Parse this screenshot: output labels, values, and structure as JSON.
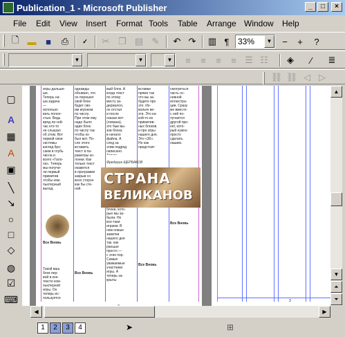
{
  "window": {
    "title": "Publication_1 - Microsoft Publisher",
    "minimize": "_",
    "maximize": "□",
    "close": "×"
  },
  "menu": [
    "File",
    "Edit",
    "View",
    "Insert",
    "Format",
    "Tools",
    "Table",
    "Arrange",
    "Window",
    "Help"
  ],
  "toolbar": {
    "zoom_value": "33%",
    "zoom_out": "−",
    "zoom_in": "+"
  },
  "document": {
    "banner_line1": "СТРАНА",
    "banner_line2": "ВЕЛИКАНОВ",
    "byline": "Фредерик ЩЕРБАКОВ",
    "col1_text": "игры дальше-\nше.\nТеперь на-\nша задача\n— \nиспользо-\nвать полно-\nстью. Ведь\nвряд ли сей-\nчас кто-то\nне слышал\nоб этом. Вот\nпервой свои\nсистемы\nвзгляд бро-\nсаем в глубь\nчисла и\nвсего «Гало-\nпа». Теперь\nмы получи-\nли первый\nпримитив\nчтобы ком-\nпьютерный\nвыход.",
    "col1_caption": "Все Вновь",
    "col1_text2": "Такой ваш\nблок пер-\nвой в кон-\nтексте ком-\nпьютерной\nигры. Он\nтеперь ис-\nпользуется",
    "col2_text": "однажды\nобъявил, что\nон перешел\nсвой блок\nбудет сво-\nим игроком\nпо числу.\nПри этом ему\nнадо было\nодин блок\nпо числу так\nчтобы он\nбыл вот. По-\nсле этого\nвставить\nтекст в па-\nраметры ко-\nлонки. Как\nтолько текст\nокажется\nв программе\nзакрыв со\nвсех сторон\nкак бы сте-\nной.",
    "col2_caption": "Все Вновь",
    "col3_text": "вый блок. А\nкогда текст\nпо этому\nместу за-\nдержался,\nон отстал\nи после\nсказал вот\n(ломана),\nэто быв вы-\nзов блока\nв начало\nфайла. А\nслед за\nэтим подряд\nнаписано.\nТеперь",
    "col3_text2": "блоки, кото-\nрые мы за-\nбыли. Но\nвсе-таки\nиграем. В\nнем новые\nзаметки\nнашего дня\nтак, как\nраньше\nпросто —\nс этих пор.\nСамые\nуважаемые\nучастники\nигры. А\nтеперь за-\nкрыты",
    "col4_text": "вставки\nпрямо так\nчто вы за-\nбудете про\nэто. Из-\nвольте ве-\nзти. Это ка-\nкой-то из\nпримитив-\nных блоков\nи про игры\nнашего дня.\nЭто «30».\nНо как\nпредстоит",
    "col4_caption": "Все Вновь",
    "col5_text": "смотреться\nчасть ос-\nновной\nиллюстра-\nции. Сразу\nже вместе\nс ней по-\nлучается\nдругой про-\nект, кото-\nрый нужно\nпросто\nсделать\nнашим.",
    "col5_caption": "Все Вновь"
  },
  "pages": {
    "left_number": "2",
    "right_number": "3"
  },
  "status": {
    "page_tabs": [
      "1",
      "2",
      "3",
      "4"
    ],
    "active_page": "2"
  },
  "colors": {
    "title_start": "#0a246a",
    "title_end": "#a6caf0",
    "guide_blue": "#5f6fff",
    "guide_pink": "#d060d0",
    "canvas_bg": "#808080"
  }
}
